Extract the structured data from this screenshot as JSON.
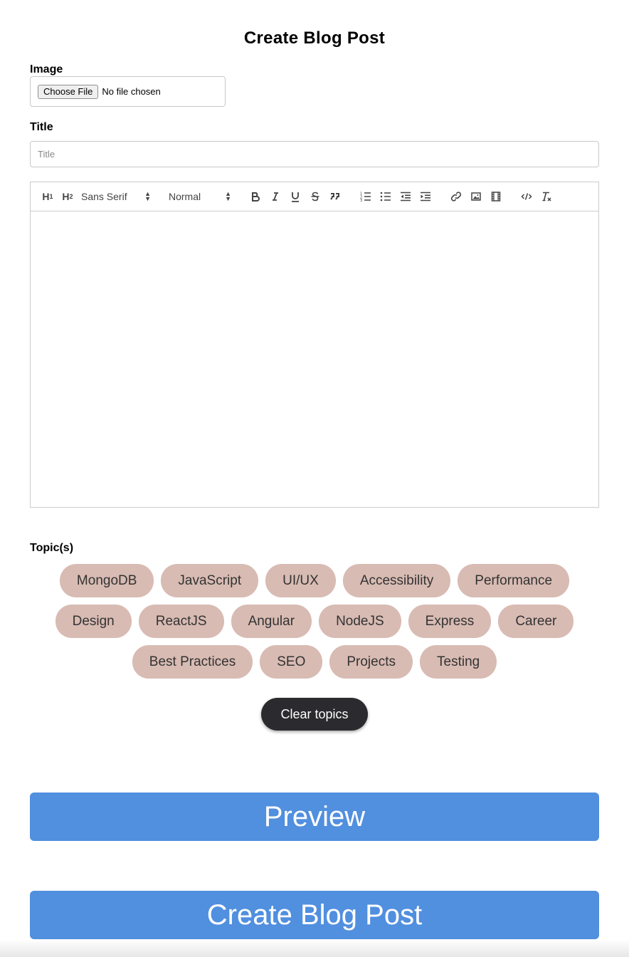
{
  "page": {
    "title": "Create Blog Post"
  },
  "image_field": {
    "label": "Image",
    "button_label": "Choose File",
    "status": "No file chosen"
  },
  "title_field": {
    "label": "Title",
    "placeholder": "Title",
    "value": ""
  },
  "editor": {
    "toolbar": {
      "heading1": "H",
      "heading1_sub": "1",
      "heading2": "H",
      "heading2_sub": "2",
      "font_picker": "Sans Serif",
      "size_picker": "Normal",
      "icons": [
        "bold-icon",
        "italic-icon",
        "underline-icon",
        "strike-icon",
        "blockquote-icon",
        "ordered-list-icon",
        "bullet-list-icon",
        "outdent-icon",
        "indent-icon",
        "link-icon",
        "image-icon",
        "video-icon",
        "code-icon",
        "clear-format-icon"
      ]
    },
    "content": ""
  },
  "topics": {
    "label": "Topic(s)",
    "items": [
      "MongoDB",
      "JavaScript",
      "UI/UX",
      "Accessibility",
      "Performance",
      "Design",
      "ReactJS",
      "Angular",
      "NodeJS",
      "Express",
      "Career",
      "Best Practices",
      "SEO",
      "Projects",
      "Testing"
    ],
    "clear_label": "Clear topics"
  },
  "actions": {
    "preview_label": "Preview",
    "create_label": "Create Blog Post"
  },
  "colors": {
    "chip_bg": "#d8bbb3",
    "primary_button": "#518fdf",
    "clear_button": "#2b2b2f"
  }
}
